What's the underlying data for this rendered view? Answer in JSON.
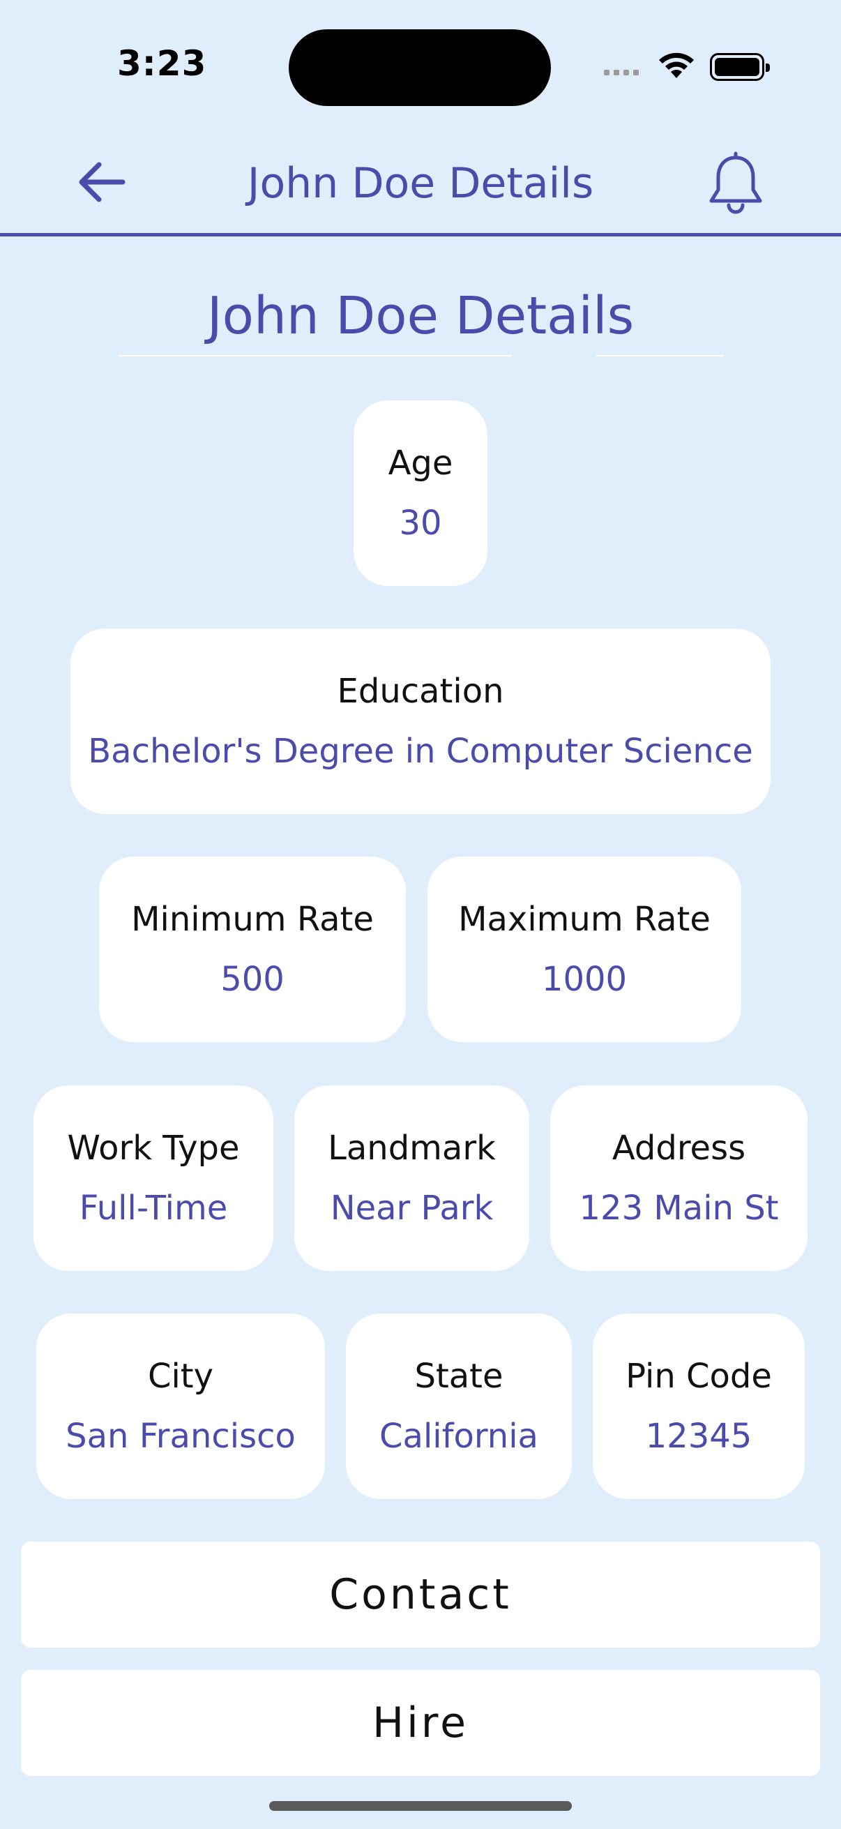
{
  "status_bar": {
    "time": "3:23"
  },
  "header": {
    "title": "John Doe Details"
  },
  "page": {
    "title": "John Doe Details"
  },
  "details": {
    "age": {
      "label": "Age",
      "value": "30"
    },
    "education": {
      "label": "Education",
      "value": "Bachelor's Degree in Computer Science"
    },
    "min_rate": {
      "label": "Minimum Rate",
      "value": "500"
    },
    "max_rate": {
      "label": "Maximum Rate",
      "value": "1000"
    },
    "work_type": {
      "label": "Work Type",
      "value": "Full-Time"
    },
    "landmark": {
      "label": "Landmark",
      "value": "Near Park"
    },
    "address": {
      "label": "Address",
      "value": "123 Main St"
    },
    "city": {
      "label": "City",
      "value": "San Francisco"
    },
    "state": {
      "label": "State",
      "value": "California"
    },
    "pin_code": {
      "label": "Pin Code",
      "value": "12345"
    }
  },
  "actions": {
    "contact_label": "Contact",
    "hire_label": "Hire"
  },
  "icons": {
    "back": "arrow-left-icon",
    "notifications": "bell-icon"
  },
  "colors": {
    "accent": "#4a4bab",
    "background": "#e0eefb",
    "card": "#ffffff"
  }
}
